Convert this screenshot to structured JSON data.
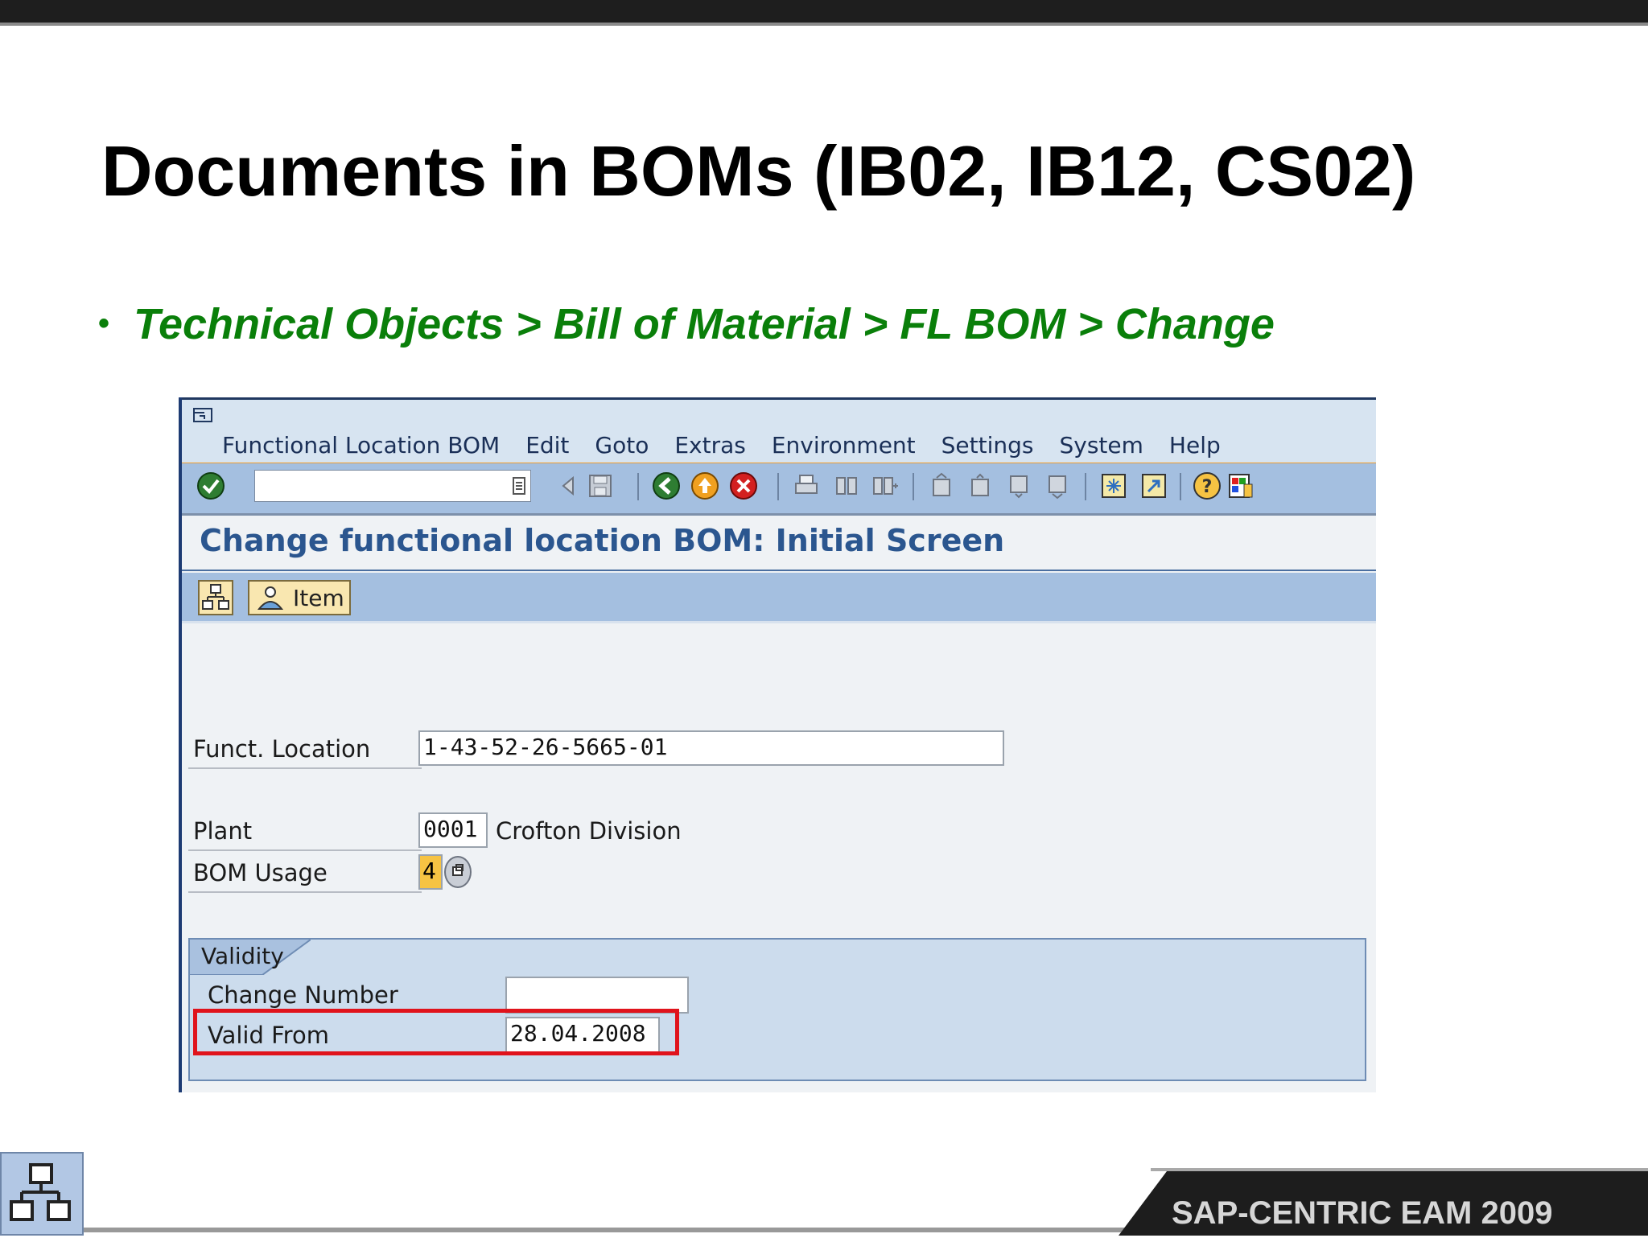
{
  "slide": {
    "title": "Documents in BOMs (IB02, IB12, CS02)",
    "bullet": "Technical Objects > Bill of Material > FL BOM > Change",
    "footer_brand": "SAP-CENTRIC EAM 2009"
  },
  "sap": {
    "menu": [
      "Functional Location BOM",
      "Edit",
      "Goto",
      "Extras",
      "Environment",
      "Settings",
      "System",
      "Help"
    ],
    "screen_title": "Change functional location BOM: Initial Screen",
    "app_toolbar": {
      "item_label": "Item"
    },
    "fields": {
      "funct_location_label": "Funct. Location",
      "funct_location_value": "1-43-52-26-5665-01",
      "plant_label": "Plant",
      "plant_value": "0001",
      "plant_desc": "Crofton Division",
      "bom_usage_label": "BOM Usage",
      "bom_usage_value": "4"
    },
    "validity": {
      "title": "Validity",
      "change_number_label": "Change Number",
      "change_number_value": "",
      "valid_from_label": "Valid From",
      "valid_from_value": "28.04.2008"
    },
    "colors": {
      "highlight": "#e0131c",
      "title_blue": "#2b568f",
      "bullet_green": "#0a7f0a"
    }
  }
}
